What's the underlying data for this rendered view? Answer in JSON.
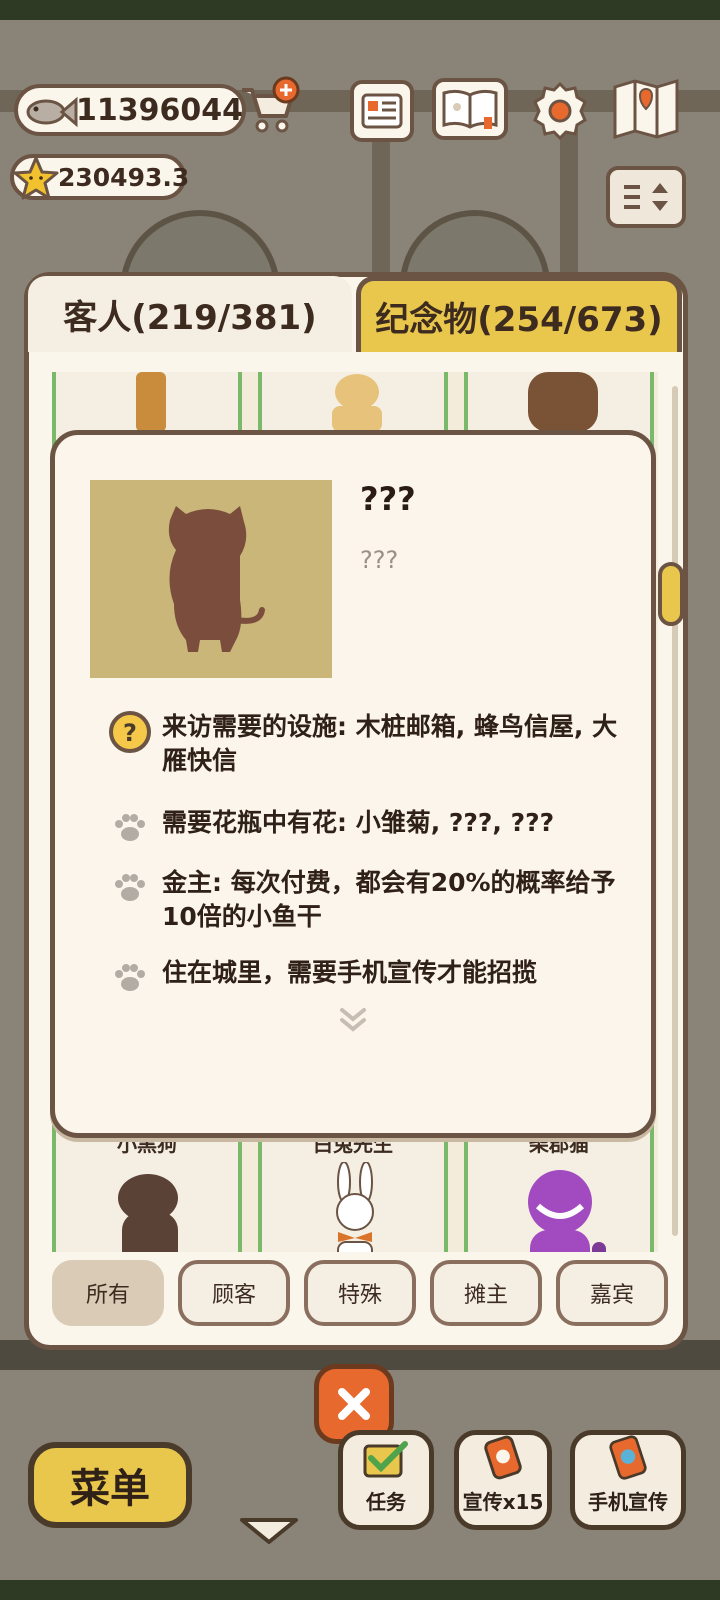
{
  "resources": {
    "fish_count": "11396044",
    "star_count": "230493.3"
  },
  "top_icons": [
    "shop-cart-icon",
    "card-icon",
    "guest-book-icon",
    "settings-gear-icon",
    "map-icon",
    "sort-toggle-icon"
  ],
  "tabs": {
    "guests": "客人(219/381)",
    "souvenirs": "纪念物(254/673)"
  },
  "grid": {
    "bottom_row_names": [
      "小黑狗",
      "白兔先生",
      "柴郡猫"
    ]
  },
  "popup": {
    "title": "???",
    "subtitle": "???",
    "features": [
      {
        "icon": "question-icon",
        "text": "来访需要的设施: 木桩邮箱, 蜂鸟信屋, 大雁快信"
      },
      {
        "icon": "paw-icon",
        "text": "需要花瓶中有花: 小雏菊, ???, ???"
      },
      {
        "icon": "paw-icon",
        "text": "金主: 每次付费，都会有20%的概率给予10倍的小鱼干"
      },
      {
        "icon": "paw-icon",
        "text": "住在城里，需要手机宣传才能招揽"
      }
    ]
  },
  "filters": [
    "所有",
    "顾客",
    "特殊",
    "摊主",
    "嘉宾"
  ],
  "bottom_bar": {
    "menu": "菜单",
    "task": "任务",
    "promote_x15": "宣传x15",
    "phone_promote": "手机宣传"
  },
  "colors": {
    "accent_yellow": "#e9c64c",
    "panel_cream": "#fbf6ec",
    "outline_brown": "#6b5444",
    "close_orange": "#e8692d",
    "cell_green_border": "#7ab86a"
  }
}
